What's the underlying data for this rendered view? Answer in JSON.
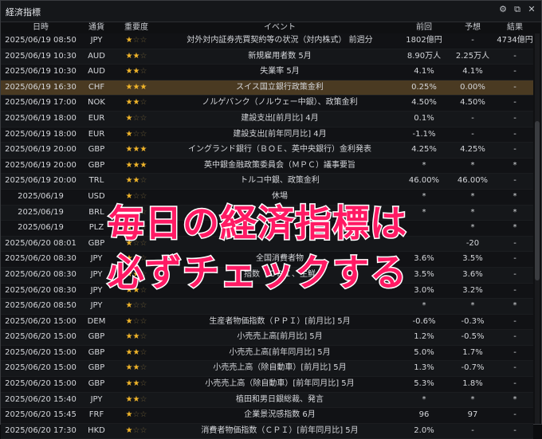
{
  "window": {
    "title": "経済指標",
    "icons": [
      "gear-icon",
      "popout-icon",
      "close-icon"
    ]
  },
  "columns": {
    "date": "日時",
    "currency": "通貨",
    "importance": "重要度",
    "event": "イベント",
    "previous": "前回",
    "forecast": "予想",
    "result": "結果"
  },
  "rows": [
    {
      "date": "2025/06/19 08:50",
      "cur": "JPY",
      "stars": 1,
      "event": "対外対内証券売買契約等の状況（対内株式） 前週分",
      "prev": "1802億円",
      "fc": "-",
      "res": "4734億円"
    },
    {
      "date": "2025/06/19 10:30",
      "cur": "AUD",
      "stars": 2,
      "event": "新規雇用者数 5月",
      "prev": "8.90万人",
      "fc": "2.25万人",
      "res": "-"
    },
    {
      "date": "2025/06/19 10:30",
      "cur": "AUD",
      "stars": 2,
      "event": "失業率 5月",
      "prev": "4.1%",
      "fc": "4.1%",
      "res": "-"
    },
    {
      "date": "2025/06/19 16:30",
      "cur": "CHF",
      "stars": 3,
      "event": "スイス国立銀行政策金利",
      "prev": "0.25%",
      "fc": "0.00%",
      "res": "-",
      "highlight": true
    },
    {
      "date": "2025/06/19 17:00",
      "cur": "NOK",
      "stars": 2,
      "event": "ノルゲバンク（ノルウェー中銀）、政策金利",
      "prev": "4.50%",
      "fc": "4.50%",
      "res": "-"
    },
    {
      "date": "2025/06/19 18:00",
      "cur": "EUR",
      "stars": 1,
      "event": "建設支出[前月比] 4月",
      "prev": "0.1%",
      "fc": "-",
      "res": "-"
    },
    {
      "date": "2025/06/19 18:00",
      "cur": "EUR",
      "stars": 1,
      "event": "建設支出[前年同月比] 4月",
      "prev": "-1.1%",
      "fc": "-",
      "res": "-"
    },
    {
      "date": "2025/06/19 20:00",
      "cur": "GBP",
      "stars": 3,
      "event": "イングランド銀行（ＢＯＥ、英中央銀行）金利発表",
      "prev": "4.25%",
      "fc": "4.25%",
      "res": "-"
    },
    {
      "date": "2025/06/19 20:00",
      "cur": "GBP",
      "stars": 3,
      "event": "英中銀金融政策委員会（ＭＰＣ）議事要旨",
      "prev": "*",
      "fc": "*",
      "res": "*"
    },
    {
      "date": "2025/06/19 20:00",
      "cur": "TRL",
      "stars": 2,
      "event": "トルコ中銀、政策金利",
      "prev": "46.00%",
      "fc": "46.00%",
      "res": "-"
    },
    {
      "date": "2025/06/19",
      "cur": "USD",
      "stars": 1,
      "event": "休場",
      "prev": "*",
      "fc": "*",
      "res": "*"
    },
    {
      "date": "2025/06/19",
      "cur": "BRL",
      "stars": 1,
      "event": "休場",
      "prev": "*",
      "fc": "*",
      "res": "*"
    },
    {
      "date": "2025/06/19",
      "cur": "PLZ",
      "stars": 1,
      "event": "",
      "prev": "",
      "fc": "*",
      "res": "*"
    },
    {
      "date": "2025/06/20 08:01",
      "cur": "GBP",
      "stars": 1,
      "event": "",
      "prev": "",
      "fc": "-20",
      "res": "-"
    },
    {
      "date": "2025/06/20 08:30",
      "cur": "JPY",
      "stars": 2,
      "event": "全国消費者物",
      "prev": "3.6%",
      "fc": "3.5%",
      "res": "-"
    },
    {
      "date": "2025/06/20 08:30",
      "cur": "JPY",
      "stars": 2,
      "event": "指数（ＣＰＩ、生鮮",
      "prev": "3.5%",
      "fc": "3.6%",
      "res": "-"
    },
    {
      "date": "2025/06/20 08:30",
      "cur": "JPY",
      "stars": 2,
      "event": "",
      "prev": "3.0%",
      "fc": "3.2%",
      "res": "-"
    },
    {
      "date": "2025/06/20 08:50",
      "cur": "JPY",
      "stars": 1,
      "event": "",
      "prev": "*",
      "fc": "*",
      "res": "*"
    },
    {
      "date": "2025/06/20 15:00",
      "cur": "DEM",
      "stars": 1,
      "event": "生産者物価指数（ＰＰＩ）[前月比] 5月",
      "prev": "-0.6%",
      "fc": "-0.3%",
      "res": "-"
    },
    {
      "date": "2025/06/20 15:00",
      "cur": "GBP",
      "stars": 2,
      "event": "小売売上高[前月比] 5月",
      "prev": "1.2%",
      "fc": "-0.5%",
      "res": "-"
    },
    {
      "date": "2025/06/20 15:00",
      "cur": "GBP",
      "stars": 2,
      "event": "小売売上高[前年同月比] 5月",
      "prev": "5.0%",
      "fc": "1.7%",
      "res": "-"
    },
    {
      "date": "2025/06/20 15:00",
      "cur": "GBP",
      "stars": 2,
      "event": "小売売上高（除自動車）[前月比] 5月",
      "prev": "1.3%",
      "fc": "-0.7%",
      "res": "-"
    },
    {
      "date": "2025/06/20 15:00",
      "cur": "GBP",
      "stars": 2,
      "event": "小売売上高（除自動車）[前年同月比] 5月",
      "prev": "5.3%",
      "fc": "1.8%",
      "res": "-"
    },
    {
      "date": "2025/06/20 15:40",
      "cur": "JPY",
      "stars": 2,
      "event": "植田和男日銀総裁、発言",
      "prev": "*",
      "fc": "*",
      "res": "*"
    },
    {
      "date": "2025/06/20 15:45",
      "cur": "FRF",
      "stars": 1,
      "event": "企業景況感指数 6月",
      "prev": "96",
      "fc": "97",
      "res": "-"
    },
    {
      "date": "2025/06/20 17:30",
      "cur": "HKD",
      "stars": 1,
      "event": "消費者物価指数（ＣＰＩ）[前年同月比] 5月",
      "prev": "2.0%",
      "fc": "-",
      "res": "-"
    }
  ],
  "overlay": {
    "line1": "毎日の経済指標は",
    "line2": "必ずチェックする"
  },
  "colors": {
    "star_on": "#f1b52a",
    "highlight": "#4a3a22",
    "overlay_text": "#ff1a64"
  }
}
